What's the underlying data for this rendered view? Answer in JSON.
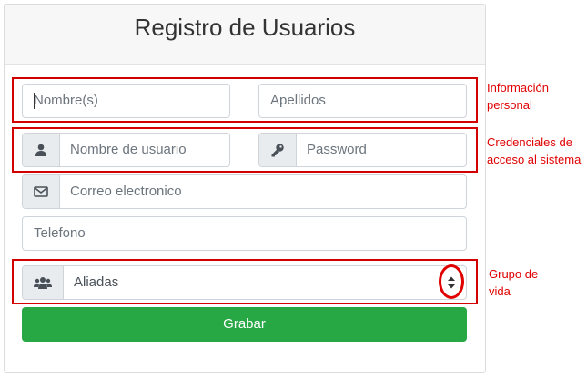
{
  "form": {
    "title": "Registro de Usuarios",
    "fields": {
      "first_name_placeholder": "Nombre(s)",
      "last_name_placeholder": "Apellidos",
      "username_placeholder": "Nombre de usuario",
      "password_placeholder": "Password",
      "email_placeholder": "Correo electronico",
      "phone_placeholder": "Telefono",
      "group_selected": "Aliadas"
    },
    "submit_label": "Grabar"
  },
  "annotations": {
    "personal_info": [
      "Información",
      "personal"
    ],
    "credentials": [
      "Credenciales de",
      "acceso al sistema"
    ],
    "life_group": [
      "Grupo de",
      "vida"
    ]
  },
  "icons": {
    "username": "user-icon",
    "password": "key-icon",
    "email": "envelope-icon",
    "group": "users-group-icon",
    "select": "sort-arrows-icon"
  },
  "colors": {
    "submit_button": "#28a745",
    "annotation": "#e00000"
  }
}
